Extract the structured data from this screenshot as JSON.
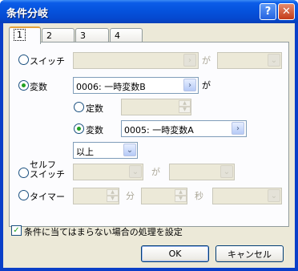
{
  "window": {
    "title": "条件分岐"
  },
  "tabs": [
    "1",
    "2",
    "3",
    "4"
  ],
  "switch_row": {
    "label": "スイッチ",
    "connector": "が"
  },
  "variable_row": {
    "label": "変数",
    "value": "0006: 一時変数B",
    "connector": "が"
  },
  "operand": {
    "constant_label": "定数",
    "variable_label": "変数",
    "variable_value": "0005: 一時変数A"
  },
  "comparison": {
    "selected": "以上"
  },
  "self_switch_row": {
    "label_line1": "セルフ",
    "label_line2": "スイッチ",
    "connector": "が"
  },
  "timer_row": {
    "label": "タイマー",
    "minutes_unit": "分",
    "seconds_unit": "秒"
  },
  "else_checkbox": {
    "label": "条件に当てはまらない場合の処理を設定",
    "checked": true
  },
  "buttons": {
    "ok": "OK",
    "cancel": "キャンセル"
  }
}
